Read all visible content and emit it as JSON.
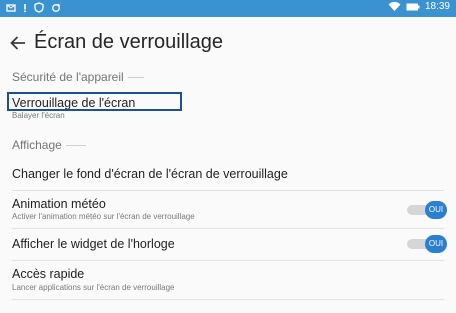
{
  "status_bar": {
    "time": "18:39",
    "left_icons": [
      "message-icon",
      "alert-icon",
      "shield-icon",
      "sync-icon",
      "moon-icon"
    ],
    "right_icons": [
      "moon-icon",
      "wifi-icon",
      "battery-icon"
    ]
  },
  "header": {
    "title": "Écran de verrouillage",
    "back_icon": "back-arrow-icon"
  },
  "sections": {
    "device_security": {
      "header": "Sécurité de l'appareil",
      "screen_lock": {
        "title": "Verrouillage de l'écran",
        "subtitle": "Balayer l'écran"
      }
    },
    "display": {
      "header": "Affichage",
      "change_wallpaper": {
        "title": "Changer le fond d'écran de l'écran de verrouillage"
      },
      "weather_animation": {
        "title": "Animation météo",
        "subtitle": "Activer l'animation météo sur l'écran de verrouillage",
        "toggle_label": "OUI",
        "enabled": true
      },
      "clock_widget": {
        "title": "Afficher le widget de l'horloge",
        "toggle_label": "OUI",
        "enabled": true
      },
      "quick_access": {
        "title": "Accès rapide",
        "subtitle": "Lancer applications sur l'écran de verrouillage"
      }
    }
  },
  "colors": {
    "status_bar": "#3a92d0",
    "accent": "#2a7fce",
    "focus": "#1d4f93"
  }
}
